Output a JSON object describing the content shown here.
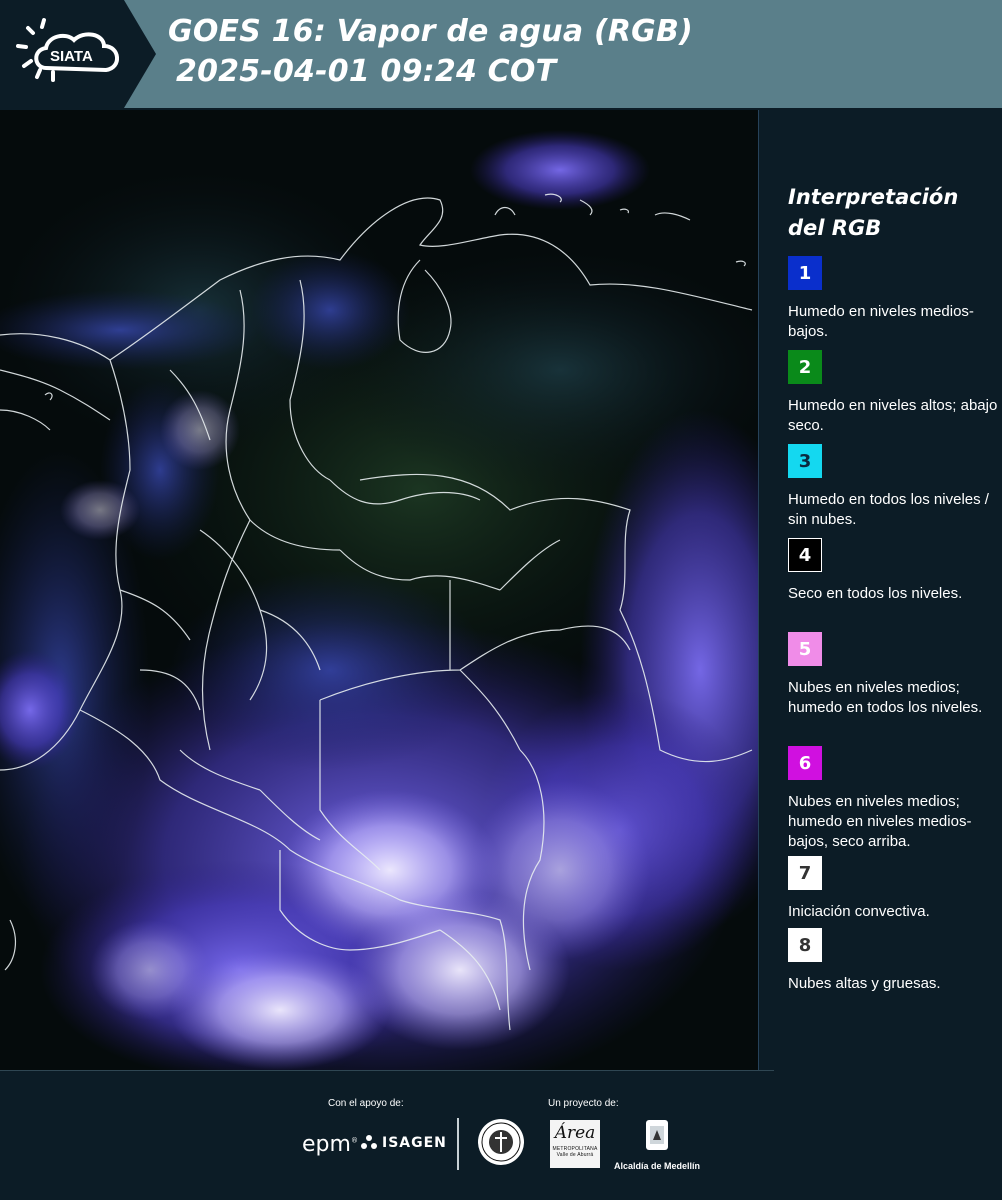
{
  "header": {
    "logo_text": "SIATA",
    "title_line1": "GOES 16: Vapor de agua (RGB)",
    "title_line2": "2025-04-01 09:24 COT"
  },
  "map": {
    "description_icon": "satellite-map"
  },
  "legend": {
    "title_line1": "Interpretación",
    "title_line2": "del RGB",
    "items": [
      {
        "number": "1",
        "color": "#0a2fcc",
        "text_color": "#ffffff",
        "description": "Humedo en niveles medios-bajos."
      },
      {
        "number": "2",
        "color": "#0a8a1a",
        "text_color": "#ffffff",
        "description": "Humedo en niveles altos; abajo seco."
      },
      {
        "number": "3",
        "color": "#14d8f0",
        "text_color": "#0a2a40",
        "description": "Humedo en todos los niveles / sin nubes."
      },
      {
        "number": "4",
        "color": "#000000",
        "text_color": "#ffffff",
        "description": "Seco en todos los niveles."
      },
      {
        "number": "5",
        "color": "#f08ce8",
        "text_color": "#ffffff",
        "description": "Nubes en niveles medios; humedo en todos los niveles."
      },
      {
        "number": "6",
        "color": "#d010e0",
        "text_color": "#ffffff",
        "description": "Nubes en niveles medios; humedo en niveles medios-bajos, seco arriba."
      },
      {
        "number": "7",
        "color": "#ffffff",
        "text_color": "#333333",
        "description": "Iniciación convectiva."
      },
      {
        "number": "8",
        "color": "#ffffff",
        "text_color": "#333333",
        "description": "Nubes altas y gruesas."
      }
    ]
  },
  "footer": {
    "support_label": "Con el apoyo de:",
    "project_label": "Un proyecto de:",
    "epm_logo": "epm",
    "isagen_logo": "ISAGEN",
    "area_logo": "Área",
    "area_subtitle": "METROPOLITANA Valle de Aburrá",
    "alcaldia_label": "Alcaldía de Medellín"
  }
}
